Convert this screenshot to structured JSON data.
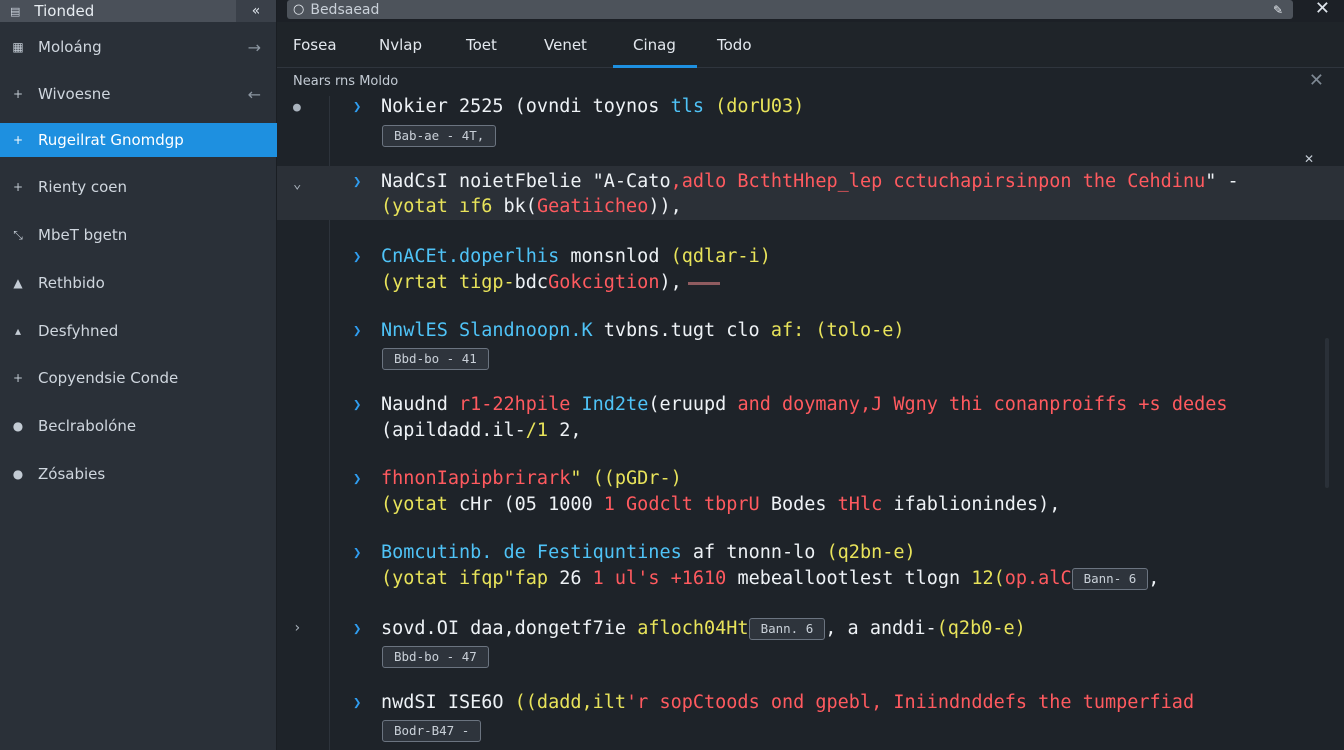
{
  "sidebar": {
    "title": "Tionded",
    "collapse_icon": "double-chevron-left-icon",
    "items": [
      {
        "label": "Moloáng",
        "icon": "grid-icon",
        "arrow": "→"
      },
      {
        "label": "Wivoesne",
        "icon": "plus-icon",
        "arrow": "←"
      },
      {
        "label": "Rugeilrat Gnomdgp",
        "icon": "plus-icon",
        "arrow": ""
      },
      {
        "label": "Rienty coen",
        "icon": "plus-icon",
        "arrow": ""
      },
      {
        "label": "MbeT bgetn",
        "icon": "expand-icon",
        "arrow": ""
      },
      {
        "label": "Rethbido",
        "icon": "triangle-icon",
        "arrow": ""
      },
      {
        "label": "Desfyhned",
        "icon": "triangle-icon",
        "arrow": ""
      },
      {
        "label": "Copyendsie Conde",
        "icon": "plus-icon",
        "arrow": ""
      },
      {
        "label": "Beclrabolóne",
        "icon": "dot-icon",
        "arrow": ""
      },
      {
        "label": "Zósabies",
        "icon": "dot-icon",
        "arrow": ""
      }
    ]
  },
  "search": {
    "value": "Bedsaead"
  },
  "tabs": [
    "Fosea",
    "Nvlap",
    "Toet",
    "Venet",
    "Cinag",
    "Todo"
  ],
  "active_tab": "Cinag",
  "panel": {
    "section_label": "Nears rns Moldo"
  },
  "entries": [
    {
      "l1": [
        [
          "w",
          "Nokier 2525 "
        ],
        [
          "w",
          "(ovndi toynos "
        ],
        [
          "c",
          "tls "
        ],
        [
          "y",
          "(dorU03)"
        ]
      ],
      "badge": "Bab-ae - 4T,"
    },
    {
      "l1": [
        [
          "w",
          "NadCsI noietFbelie \"A-Cato"
        ],
        [
          "r",
          ",adlo BcthtHhep_lep cctuchapirsinpon the Cehdinu"
        ],
        [
          "w",
          "\" -"
        ]
      ],
      "l2": [
        [
          "y",
          "(yotat ıf6 "
        ],
        [
          "w",
          "bk("
        ],
        [
          "r",
          "Geatiicheo"
        ],
        [
          "w",
          "))"
        ],
        [
          "w",
          ","
        ]
      ]
    },
    {
      "l1": [
        [
          "c",
          "CnACEt.doperlhis "
        ],
        [
          "w",
          "monsnlod "
        ],
        [
          "y",
          "(qdlar-i)"
        ]
      ],
      "l2": [
        [
          "y",
          "(yrtat tigp-"
        ],
        [
          "w",
          "bdc"
        ],
        [
          "r",
          "Gokcigtion"
        ],
        [
          "w",
          "),"
        ]
      ]
    },
    {
      "l1": [
        [
          "c",
          "NnwlES Slandnoopn.K "
        ],
        [
          "w",
          "tvbns.tugt clo "
        ],
        [
          "y",
          "af: (tolo-e)"
        ]
      ],
      "badge": "Bbd-bo - 41"
    },
    {
      "l1": [
        [
          "w",
          "Naudnd "
        ],
        [
          "r",
          "r1-22hpile "
        ],
        [
          "c",
          "Ind2te"
        ],
        [
          "w",
          "(eruupd "
        ],
        [
          "r",
          "and doymany,J Wgny thi conanproiffs +s dedes"
        ]
      ],
      "l2": [
        [
          "w",
          "(apildadd.il-"
        ],
        [
          "y",
          "/1 "
        ],
        [
          "w",
          "2,"
        ]
      ]
    },
    {
      "l1": [
        [
          "r",
          "fhnonIapipbrirark"
        ],
        [
          "y",
          "\" ((pGDr-)"
        ]
      ],
      "l2": [
        [
          "y",
          "(yotat "
        ],
        [
          "w",
          "cHr (05 1000 "
        ],
        [
          "r",
          "1 Godclt tbprU "
        ],
        [
          "w",
          "Bodes "
        ],
        [
          "r",
          "tHlc "
        ],
        [
          "w",
          "ifablionindes),"
        ]
      ]
    },
    {
      "l1": [
        [
          "c",
          "Bomcutinb. de Festiquntines "
        ],
        [
          "w",
          "af tnonn-lo "
        ],
        [
          "y",
          "(q2bn-e)"
        ]
      ],
      "l2": [
        [
          "y",
          "(yotat ifqp\"fap "
        ],
        [
          "w",
          "26 "
        ],
        [
          "r",
          "1 ul's +1610 "
        ],
        [
          "w",
          "mebeallootlest tlogn "
        ],
        [
          "y",
          "12("
        ],
        [
          "r",
          "op.alC"
        ]
      ],
      "badge2": "Bann- 6",
      "tail2": ","
    },
    {
      "l1": [
        [
          "w",
          "sovd.OI daa,dongetf7ie "
        ],
        [
          "y",
          "afloch04Ht"
        ]
      ],
      "inline_badge": "Bann. 6",
      "l1b": [
        [
          "w",
          ", a anddi-"
        ],
        [
          "y",
          "(q2b0-e)"
        ]
      ],
      "badge": "Bbd-bo - 47"
    },
    {
      "l1": [
        [
          "w",
          "nwdSI ISE6O "
        ],
        [
          "y",
          "((dadd,ilt"
        ],
        [
          "r",
          "'r sopCtoods ond gpebl, Iniindnddefs the tumperfiad"
        ]
      ],
      "badge": "Bodr-B47 -"
    }
  ]
}
